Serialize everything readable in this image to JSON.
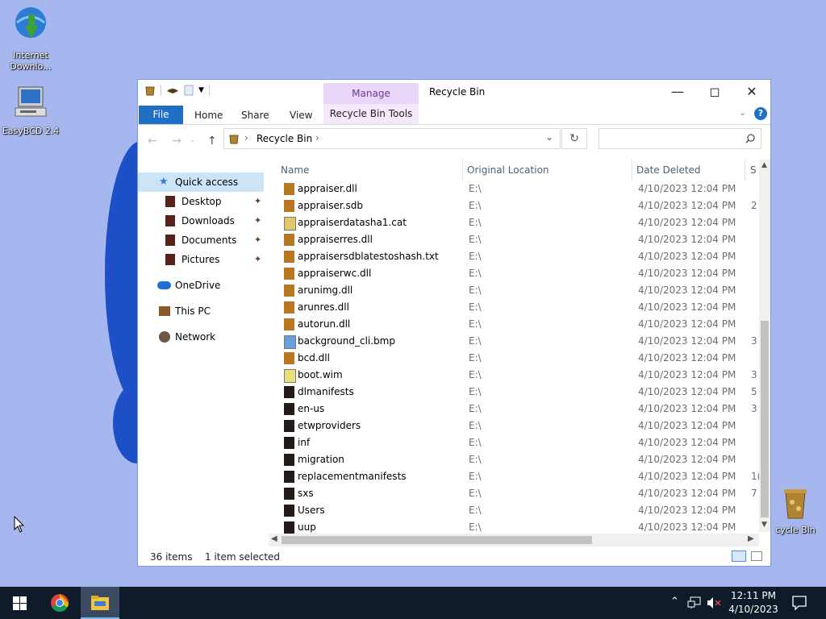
{
  "desktop": {
    "icons": [
      {
        "label": "Internet\nDownlo...",
        "name": "internet-download-manager-icon"
      },
      {
        "label": "EasyBCD 2.4",
        "name": "easybcd-icon"
      },
      {
        "label": "cycle Bin",
        "name": "recycle-bin-icon"
      }
    ]
  },
  "window": {
    "title": "Recycle Bin",
    "manage_label": "Manage",
    "ribbon": {
      "file": "File",
      "home": "Home",
      "share": "Share",
      "view": "View",
      "tools": "Recycle Bin Tools"
    },
    "address": {
      "path": "Recycle Bin",
      "search_placeholder": ""
    },
    "nav": {
      "quick_access": "Quick access",
      "desktop": "Desktop",
      "downloads": "Downloads",
      "documents": "Documents",
      "pictures": "Pictures",
      "onedrive": "OneDrive",
      "thispc": "This PC",
      "network": "Network"
    },
    "columns": {
      "name": "Name",
      "location": "Original Location",
      "date": "Date Deleted",
      "size": "S"
    },
    "files": [
      {
        "name": "appraiser.dll",
        "location": "E:\\",
        "date": "4/10/2023 12:04 PM",
        "size": "",
        "icon": "dll"
      },
      {
        "name": "appraiser.sdb",
        "location": "E:\\",
        "date": "4/10/2023 12:04 PM",
        "size": "2",
        "icon": "dll"
      },
      {
        "name": "appraiserdatasha1.cat",
        "location": "E:\\",
        "date": "4/10/2023 12:04 PM",
        "size": "",
        "icon": "cat"
      },
      {
        "name": "appraiserres.dll",
        "location": "E:\\",
        "date": "4/10/2023 12:04 PM",
        "size": "",
        "icon": "dll"
      },
      {
        "name": "appraisersdblatestoshash.txt",
        "location": "E:\\",
        "date": "4/10/2023 12:04 PM",
        "size": "",
        "icon": "dll"
      },
      {
        "name": "appraiserwc.dll",
        "location": "E:\\",
        "date": "4/10/2023 12:04 PM",
        "size": "",
        "icon": "dll"
      },
      {
        "name": "arunimg.dll",
        "location": "E:\\",
        "date": "4/10/2023 12:04 PM",
        "size": "",
        "icon": "dll"
      },
      {
        "name": "arunres.dll",
        "location": "E:\\",
        "date": "4/10/2023 12:04 PM",
        "size": "",
        "icon": "dll"
      },
      {
        "name": "autorun.dll",
        "location": "E:\\",
        "date": "4/10/2023 12:04 PM",
        "size": "",
        "icon": "dll"
      },
      {
        "name": "background_cli.bmp",
        "location": "E:\\",
        "date": "4/10/2023 12:04 PM",
        "size": "3",
        "icon": "bmp"
      },
      {
        "name": "bcd.dll",
        "location": "E:\\",
        "date": "4/10/2023 12:04 PM",
        "size": "",
        "icon": "dll"
      },
      {
        "name": "boot.wim",
        "location": "E:\\",
        "date": "4/10/2023 12:04 PM",
        "size": "3",
        "icon": "wim"
      },
      {
        "name": "dlmanifests",
        "location": "E:\\",
        "date": "4/10/2023 12:04 PM",
        "size": "5",
        "icon": "folder"
      },
      {
        "name": "en-us",
        "location": "E:\\",
        "date": "4/10/2023 12:04 PM",
        "size": "3",
        "icon": "folder"
      },
      {
        "name": "etwproviders",
        "location": "E:\\",
        "date": "4/10/2023 12:04 PM",
        "size": "",
        "icon": "folder"
      },
      {
        "name": "inf",
        "location": "E:\\",
        "date": "4/10/2023 12:04 PM",
        "size": "",
        "icon": "folder"
      },
      {
        "name": "migration",
        "location": "E:\\",
        "date": "4/10/2023 12:04 PM",
        "size": "",
        "icon": "folder"
      },
      {
        "name": "replacementmanifests",
        "location": "E:\\",
        "date": "4/10/2023 12:04 PM",
        "size": "1(",
        "icon": "folder"
      },
      {
        "name": "sxs",
        "location": "E:\\",
        "date": "4/10/2023 12:04 PM",
        "size": "7",
        "icon": "folder"
      },
      {
        "name": "Users",
        "location": "E:\\",
        "date": "4/10/2023 12:04 PM",
        "size": "",
        "icon": "folder"
      },
      {
        "name": "uup",
        "location": "E:\\",
        "date": "4/10/2023 12:04 PM",
        "size": "",
        "icon": "folder"
      }
    ],
    "status": {
      "count": "36 items",
      "selected": "1 item selected"
    }
  },
  "taskbar": {
    "time": "12:11 PM",
    "date": "4/10/2023"
  },
  "colors": {
    "desktop": "#a6b7ef",
    "taskbar": "#101b29",
    "accent": "#1f6fc5",
    "manage_tab": "#e9d5f7"
  }
}
